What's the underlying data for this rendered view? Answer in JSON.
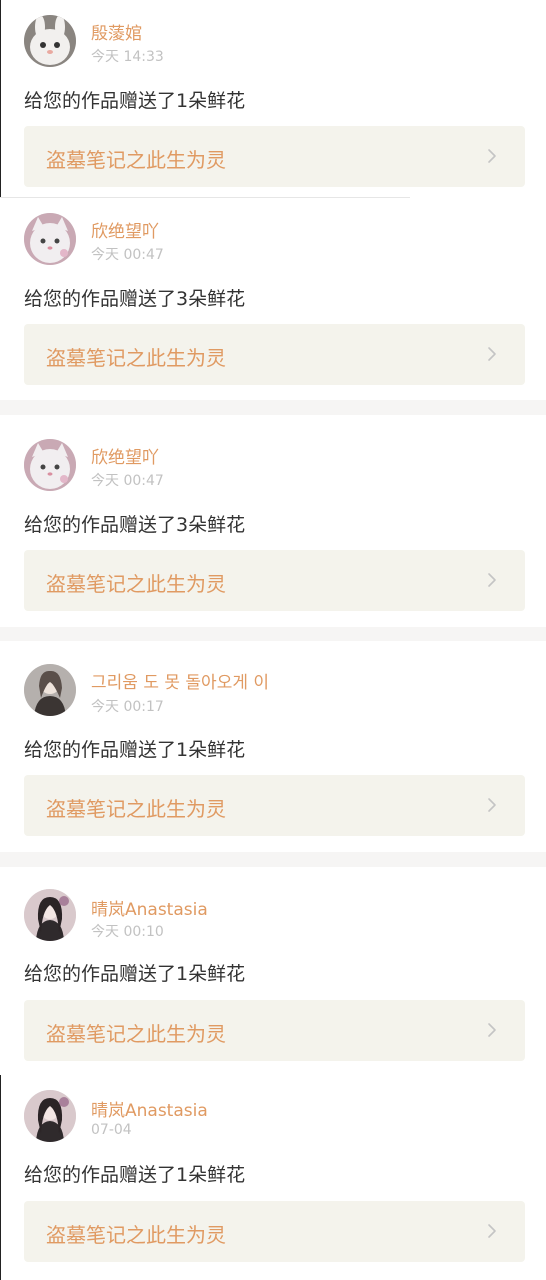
{
  "colors": {
    "accent": "#e09a62",
    "page_background": "#f6f5f4",
    "card_background": "#ffffff",
    "link_background": "#f4f3ec",
    "timestamp": "#c2c2c2",
    "message": "#333333"
  },
  "notifications": [
    {
      "username": "殷蔆婠",
      "time": "今天 14:33",
      "message": "给您的作品赠送了1朵鲜花",
      "work_title": "盗墓笔记之此生为灵",
      "avatar_icon": "rabbit-avatar-icon"
    },
    {
      "username": "欣绝望吖",
      "time": "今天 00:47",
      "message": "给您的作品赠送了3朵鲜花",
      "work_title": "盗墓笔记之此生为灵",
      "avatar_icon": "cat-avatar-icon"
    },
    {
      "username": "欣绝望吖",
      "time": "今天 00:47",
      "message": "给您的作品赠送了3朵鲜花",
      "work_title": "盗墓笔记之此生为灵",
      "avatar_icon": "cat-avatar-icon"
    },
    {
      "username": "그리움 도 못 돌아오게 이",
      "time": "今天 00:17",
      "message": "给您的作品赠送了1朵鲜花",
      "work_title": "盗墓笔记之此生为灵",
      "avatar_icon": "person-avatar-icon"
    },
    {
      "username": "晴岚Anastasia",
      "time": "今天 00:10",
      "message": "给您的作品赠送了1朵鲜花",
      "work_title": "盗墓笔记之此生为灵",
      "avatar_icon": "person-avatar-icon"
    },
    {
      "username": "晴岚Anastasia",
      "time": "07-04",
      "message": "给您的作品赠送了1朵鲜花",
      "work_title": "盗墓笔记之此生为灵",
      "avatar_icon": "person-avatar-icon"
    }
  ]
}
